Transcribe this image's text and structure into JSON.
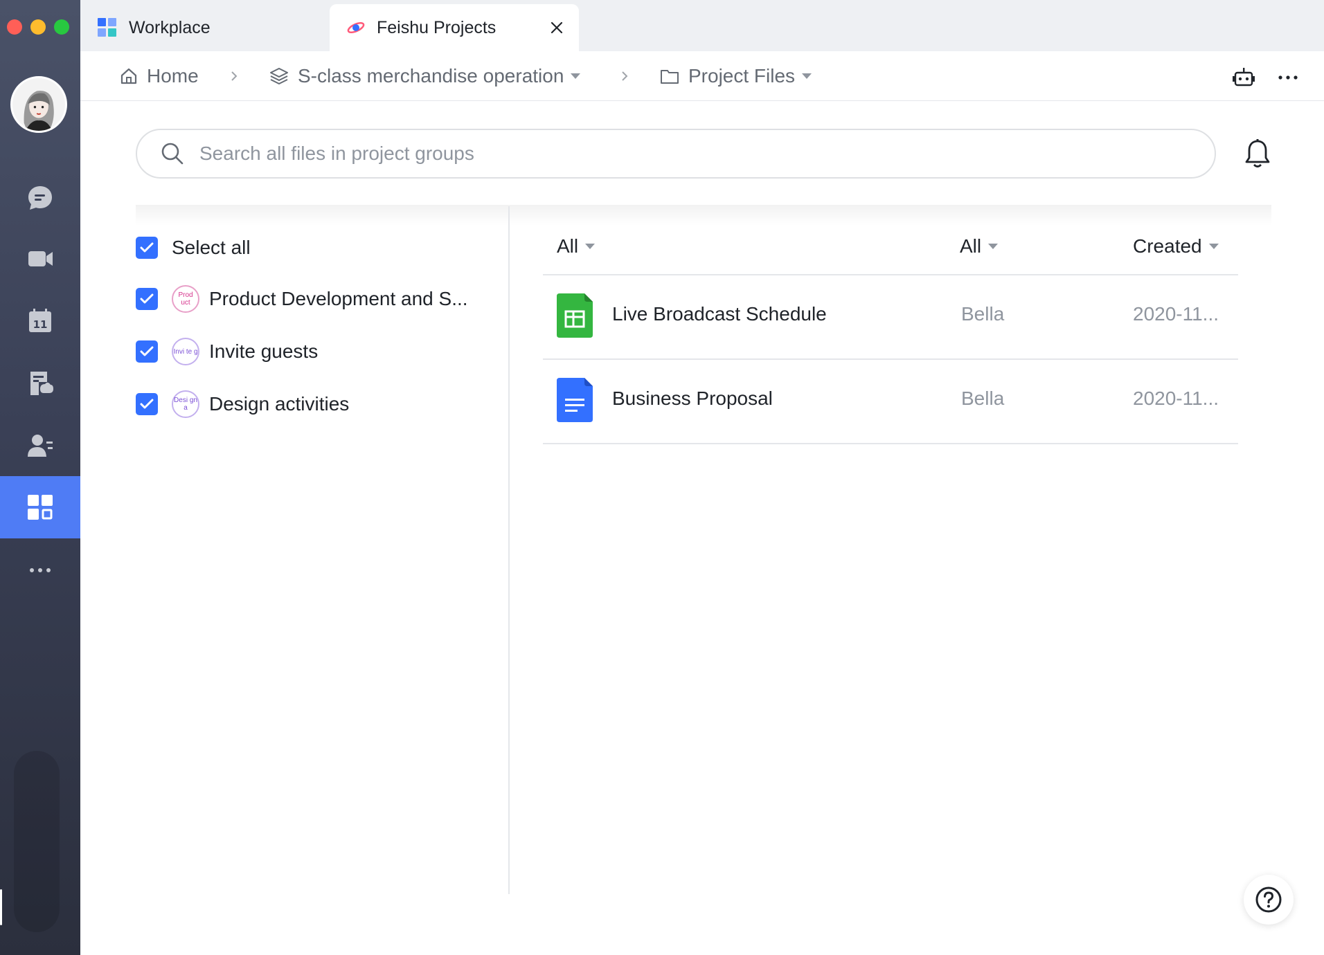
{
  "tabs": [
    {
      "label": "Workplace",
      "active": false,
      "icon": "workplace-grid-icon"
    },
    {
      "label": "Feishu Projects",
      "active": true,
      "icon": "feishu-projects-logo-icon"
    }
  ],
  "breadcrumb": {
    "home": "Home",
    "project": "S-class merchandise operation",
    "folder": "Project Files"
  },
  "search": {
    "placeholder": "Search all files in project groups"
  },
  "filters": {
    "select_all": "Select all",
    "groups": [
      {
        "label": "Product Development and S...",
        "avatar_text": "Prod uct",
        "color": "#d6338c",
        "checked": true
      },
      {
        "label": "Invite guests",
        "avatar_text": "Invi te g",
        "color": "#7b4fd6",
        "checked": true
      },
      {
        "label": "Design activities",
        "avatar_text": "Desi gn a",
        "color": "#7b4fd6",
        "checked": true
      }
    ]
  },
  "table": {
    "columns": {
      "type": "All",
      "owner": "All",
      "sort": "Created"
    },
    "rows": [
      {
        "name": "Live Broadcast Schedule",
        "owner": "Bella",
        "date": "2020-11...",
        "icon": "sheet-file-icon"
      },
      {
        "name": "Business Proposal",
        "owner": "Bella",
        "date": "2020-11...",
        "icon": "doc-file-icon"
      }
    ]
  },
  "colors": {
    "accent": "#3370ff",
    "rail_active": "#4f7cf5",
    "sheet": "#34b640",
    "doc": "#3370ff"
  }
}
